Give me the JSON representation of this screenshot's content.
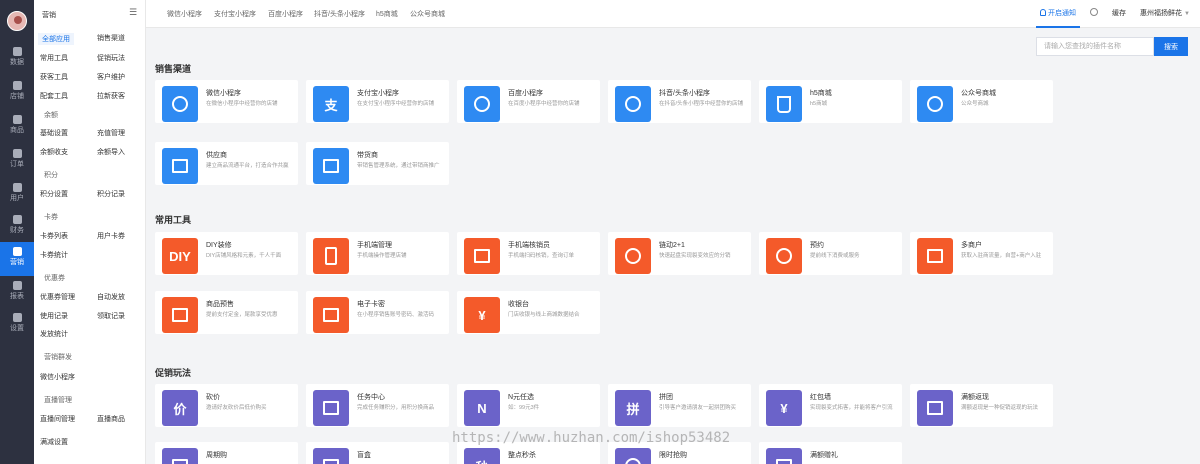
{
  "rail": [
    {
      "label": "数据",
      "icon": "home-icon"
    },
    {
      "label": "店铺",
      "icon": "store-icon"
    },
    {
      "label": "商品",
      "icon": "bag-icon"
    },
    {
      "label": "订单",
      "icon": "order-icon"
    },
    {
      "label": "用户",
      "icon": "user-icon"
    },
    {
      "label": "财务",
      "icon": "finance-icon"
    },
    {
      "label": "营销",
      "icon": "grid-icon",
      "active": true
    },
    {
      "label": "报表",
      "icon": "report-icon"
    },
    {
      "label": "设置",
      "icon": "gear-icon"
    }
  ],
  "sidebar": {
    "title": "营销",
    "links": {
      "all_apps": "全部应用",
      "sales_channels": "销售渠道",
      "common_tools": "常用工具",
      "promo_play": "促销玩法",
      "acquire_tools": "获客工具",
      "customer_care": "客户维护",
      "delivery_tools": "配套工具",
      "referral": "拉新获客",
      "balance_settings": "基础设置",
      "recharge_mgmt": "充值管理",
      "balance_flow": "余额收支",
      "balance_import": "余额导入",
      "points_settings": "积分设置",
      "points_log": "积分记录",
      "card_list": "卡券列表",
      "user_cards": "用户卡券",
      "card_stats": "卡券统计",
      "coupon_mgmt": "优惠券管理",
      "auto_issue": "自动发放",
      "usage_log": "使用记录",
      "claim_log": "领取记录",
      "issue_stats": "发放统计",
      "wx_miniapp": "微信小程序",
      "live_mgmt": "直播间管理",
      "live_goods": "直播商品",
      "full_reduce": "满减设置"
    },
    "groups": {
      "balance": "余额",
      "points": "积分",
      "cards": "卡券",
      "coupons": "优惠券",
      "mass_msg": "营销群发",
      "live": "直播管理"
    }
  },
  "topbar": {
    "tabs": [
      "微信小程序",
      "支付宝小程序",
      "百度小程序",
      "抖音/头条小程序",
      "h5商城",
      "公众号商城"
    ],
    "notify": "开启通知",
    "cache": "缓存",
    "user": "惠州福扬鲜花"
  },
  "search": {
    "placeholder": "请输入您查找的插件名称",
    "button": "搜索"
  },
  "sections": {
    "channels": {
      "title": "销售渠道",
      "cards": [
        {
          "name": "微信小程序",
          "desc": "在微信小程序中经营你的店铺"
        },
        {
          "name": "支付宝小程序",
          "desc": "在支付宝小程序中经营你的店铺"
        },
        {
          "name": "百度小程序",
          "desc": "在百度小程序中经营你的店铺"
        },
        {
          "name": "抖音/头条小程序",
          "desc": "在抖音/头条小程序中经营你的店铺"
        },
        {
          "name": "h5商城",
          "desc": "h5商城"
        },
        {
          "name": "公众号商城",
          "desc": "公众号商城"
        },
        {
          "name": "供应商",
          "desc": "建立商品流通平台，打造合作共赢"
        },
        {
          "name": "带货商",
          "desc": "带销售管理系统，通过带销商推广"
        }
      ]
    },
    "tools": {
      "title": "常用工具",
      "cards": [
        {
          "name": "DIY装修",
          "desc": "DIY店铺风格和元素，千人千面",
          "glyph": "DIY"
        },
        {
          "name": "手机端管理",
          "desc": "手机端操作管理店铺"
        },
        {
          "name": "手机端核销员",
          "desc": "手机端扫码核销，查询订单"
        },
        {
          "name": "链动2+1",
          "desc": "快速起盘实现裂变效应的分销"
        },
        {
          "name": "预约",
          "desc": "提前线下消费或服务"
        },
        {
          "name": "多商户",
          "desc": "获取入驻商流量，自营+商户入驻"
        },
        {
          "name": "商品预售",
          "desc": "提前支付定金，尾款享受优惠"
        },
        {
          "name": "电子卡密",
          "desc": "在小程序销售账号密码、激活码"
        },
        {
          "name": "收银台",
          "desc": "门店收银与线上商城数据结合",
          "glyph": "¥"
        }
      ]
    },
    "promos": {
      "title": "促销玩法",
      "cards": [
        {
          "name": "砍价",
          "desc": "邀请好友砍价后低价购买",
          "glyph": "价"
        },
        {
          "name": "任务中心",
          "desc": "完成任务赚积分，用积分换商品"
        },
        {
          "name": "N元任选",
          "desc": "如：99元3件",
          "glyph": "N"
        },
        {
          "name": "拼团",
          "desc": "引导客户邀请朋友一起拼团购买",
          "glyph": "拼"
        },
        {
          "name": "红包墙",
          "desc": "实现裂变式拓客，并能将客户引流",
          "glyph": "¥"
        },
        {
          "name": "满额返现",
          "desc": "满额返现是一种促销返现的玩法"
        },
        {
          "name": "周期购",
          "desc": ""
        },
        {
          "name": "盲盒",
          "desc": ""
        },
        {
          "name": "整点秒杀",
          "desc": "",
          "glyph": "秒"
        },
        {
          "name": "限时抢购",
          "desc": ""
        },
        {
          "name": "满额赠礼",
          "desc": ""
        }
      ]
    }
  },
  "watermark": "https://www.huzhan.com/ishop53482",
  "colors": {
    "accent": "#1a74e8",
    "orange": "#f45a2a",
    "purple": "#6b63c9",
    "rail": "#2d3140"
  }
}
